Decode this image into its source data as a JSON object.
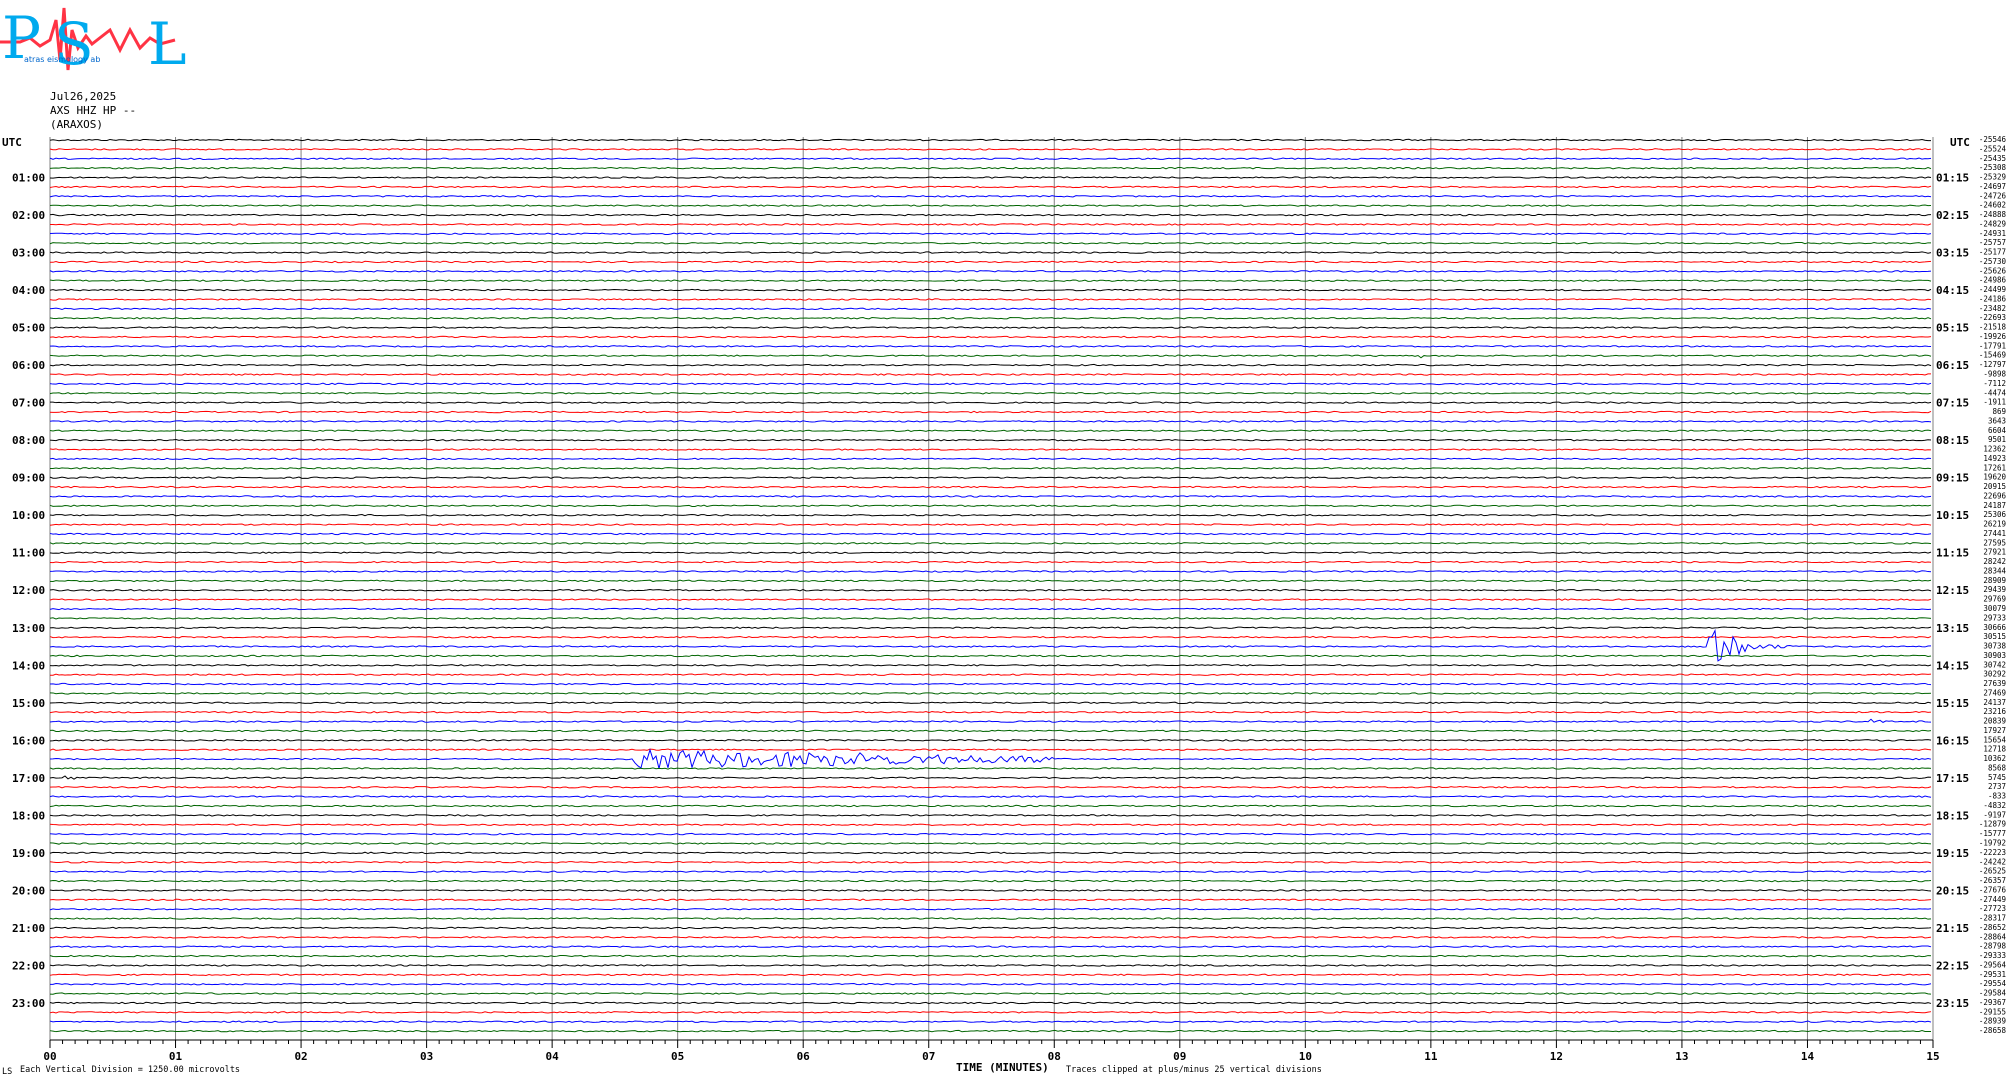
{
  "header": {
    "logo_letters": [
      "P",
      "S",
      "L"
    ],
    "logo_small": "atras   eismology   ab",
    "date": "Jul26,2025",
    "station": "AXS HHZ HP --",
    "location": "(ARAXOS)"
  },
  "footer": {
    "division": "Each Vertical Division = 1250.00 microvolts",
    "xlabel": "TIME (MINUTES)",
    "clipped": "Traces clipped at plus/minus 25 vertical divisions",
    "corner_mark": "LS"
  },
  "colors": {
    "black": "#000000",
    "red": "#ff0000",
    "blue": "#0000ff",
    "green": "#006400",
    "grid": "#808080",
    "logo_blue": "#00aaee",
    "logo_red": "#ff3344"
  },
  "chart_data": {
    "type": "line",
    "title": "",
    "x_ticks": [
      "00",
      "01",
      "02",
      "03",
      "04",
      "05",
      "06",
      "07",
      "08",
      "09",
      "10",
      "11",
      "12",
      "13",
      "14",
      "15"
    ],
    "xlim": [
      0,
      15
    ],
    "left_corner": "UTC",
    "right_corner": "UTC",
    "trace_colors": [
      "black",
      "red",
      "blue",
      "green"
    ],
    "traces_per_hour": 4,
    "total_traces": 96,
    "left_labels": [
      "01:00",
      "02:00",
      "03:00",
      "04:00",
      "05:00",
      "06:00",
      "07:00",
      "08:00",
      "09:00",
      "10:00",
      "11:00",
      "12:00",
      "13:00",
      "14:00",
      "15:00",
      "16:00",
      "17:00",
      "18:00",
      "19:00",
      "20:00",
      "21:00",
      "22:00",
      "23:00"
    ],
    "right_labels": [
      "01:15",
      "02:15",
      "03:15",
      "04:15",
      "05:15",
      "06:15",
      "07:15",
      "08:15",
      "09:15",
      "10:15",
      "11:15",
      "12:15",
      "13:15",
      "14:15",
      "15:15",
      "16:15",
      "17:15",
      "18:15",
      "19:15",
      "20:15",
      "21:15",
      "22:15",
      "23:15"
    ],
    "trace_values": [
      "-25546",
      "-25524",
      "-25435",
      "-25308",
      "-25329",
      "-24697",
      "-24726",
      "-24602",
      "-24888",
      "-24829",
      "-24931",
      "-25757",
      "-25177",
      "-25730",
      "-25626",
      "-24986",
      "-24499",
      "-24186",
      "-23482",
      "-22693",
      "-21518",
      "-19926",
      "-17791",
      "-15469",
      "-12797",
      "-9898",
      "-7112",
      "-4474",
      "-1911",
      "869",
      "3643",
      "6604",
      "9501",
      "12362",
      "14923",
      "17261",
      "19620",
      "20915",
      "22696",
      "24187",
      "25306",
      "26219",
      "27441",
      "27595",
      "27921",
      "28242",
      "28344",
      "28909",
      "29439",
      "29769",
      "30079",
      "29733",
      "30666",
      "30515",
      "30738",
      "30903",
      "30742",
      "30292",
      "27639",
      "27469",
      "24137",
      "23216",
      "20839",
      "17927",
      "15654",
      "12718",
      "10362",
      "8568",
      "5745",
      "2737",
      "-833",
      "-4832",
      "-9197",
      "-12879",
      "-15777",
      "-19792",
      "-22223",
      "-24242",
      "-26525",
      "-26357",
      "-27676",
      "-27449",
      "-27723",
      "-28317",
      "-28652",
      "-28864",
      "-28798",
      "-29333",
      "-29564",
      "-29531",
      "-29554",
      "-29584",
      "-29367",
      "-29155",
      "-28939",
      "-28658"
    ],
    "events": [
      {
        "trace": 54,
        "start_min": 13.2,
        "end_min": 13.9,
        "amplitude": 22,
        "type": "local_event"
      },
      {
        "trace": 62,
        "start_min": 14.5,
        "end_min": 14.65,
        "amplitude": 4,
        "type": "spike"
      },
      {
        "trace": 61,
        "start_min": 10.2,
        "end_min": 10.3,
        "amplitude": 3,
        "type": "spike"
      },
      {
        "trace": 66,
        "start_min": 4.65,
        "end_min": 8.0,
        "amplitude": 10,
        "type": "teleseism"
      },
      {
        "trace": 68,
        "start_min": 0.1,
        "end_min": 0.3,
        "amplitude": 5,
        "type": "spike"
      },
      {
        "trace": 34,
        "start_min": 8.8,
        "end_min": 8.9,
        "amplitude": 3,
        "type": "spike"
      },
      {
        "trace": 23,
        "start_min": 10.9,
        "end_min": 11.0,
        "amplitude": 3,
        "type": "spike"
      }
    ]
  }
}
